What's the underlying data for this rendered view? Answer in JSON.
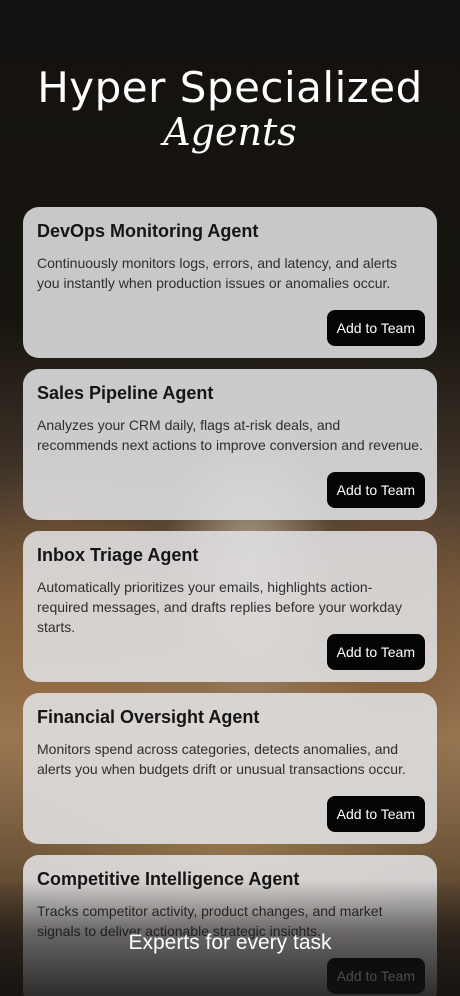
{
  "hero": {
    "title": "Hyper Specialized",
    "subtitle": "Agents"
  },
  "agents": [
    {
      "title": "DevOps Monitoring Agent",
      "description": "Continuously monitors logs, errors, and latency, and alerts you instantly when production issues or anomalies occur.",
      "button": "Add to Team"
    },
    {
      "title": "Sales Pipeline Agent",
      "description": "Analyzes your CRM daily, flags at-risk deals, and recommends next actions to improve conversion and revenue.",
      "button": "Add to Team"
    },
    {
      "title": "Inbox Triage Agent",
      "description": "Automatically prioritizes your emails, highlights action-required messages, and drafts replies before your workday starts.",
      "button": "Add to Team"
    },
    {
      "title": "Financial Oversight Agent",
      "description": "Monitors spend across categories, detects anomalies, and alerts you when budgets drift or unusual transactions occur.",
      "button": "Add to Team"
    },
    {
      "title": "Competitive Intelligence Agent",
      "description": "Tracks competitor activity, product changes, and market signals to deliver actionable strategic insights.",
      "button": "Add to Team"
    }
  ],
  "footer": {
    "tagline": "Experts for every task"
  }
}
